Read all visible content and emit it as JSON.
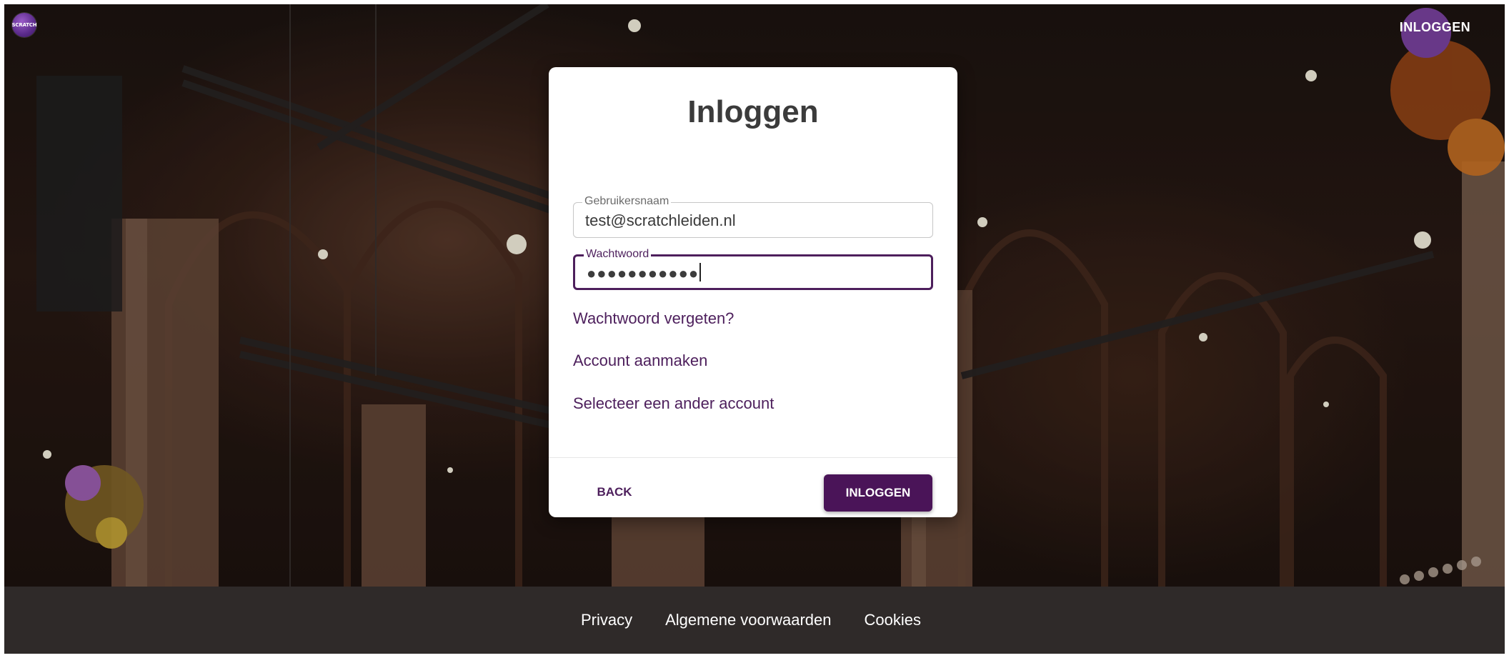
{
  "header": {
    "logo_text": "SCRATCH",
    "login_label": "INLOGGEN"
  },
  "dialog": {
    "title": "Inloggen",
    "username": {
      "label": "Gebruikersnaam",
      "value": "test@scratchleiden.nl"
    },
    "password": {
      "label": "Wachtwoord",
      "value": "●●●●●●●●●●●"
    },
    "links": {
      "forgot_password": "Wachtwoord vergeten?",
      "create_account": "Account aanmaken",
      "select_other_account": "Selecteer een ander account"
    },
    "back_label": "BACK",
    "submit_label": "INLOGGEN"
  },
  "footer": {
    "links": [
      "Privacy",
      "Algemene voorwaarden",
      "Cookies"
    ]
  },
  "colors": {
    "accent": "#4d1f5c",
    "primary_button": "#4a1458",
    "footer_background": "#2f2a29"
  },
  "icons": {
    "logo": "scratch-logo-icon"
  }
}
